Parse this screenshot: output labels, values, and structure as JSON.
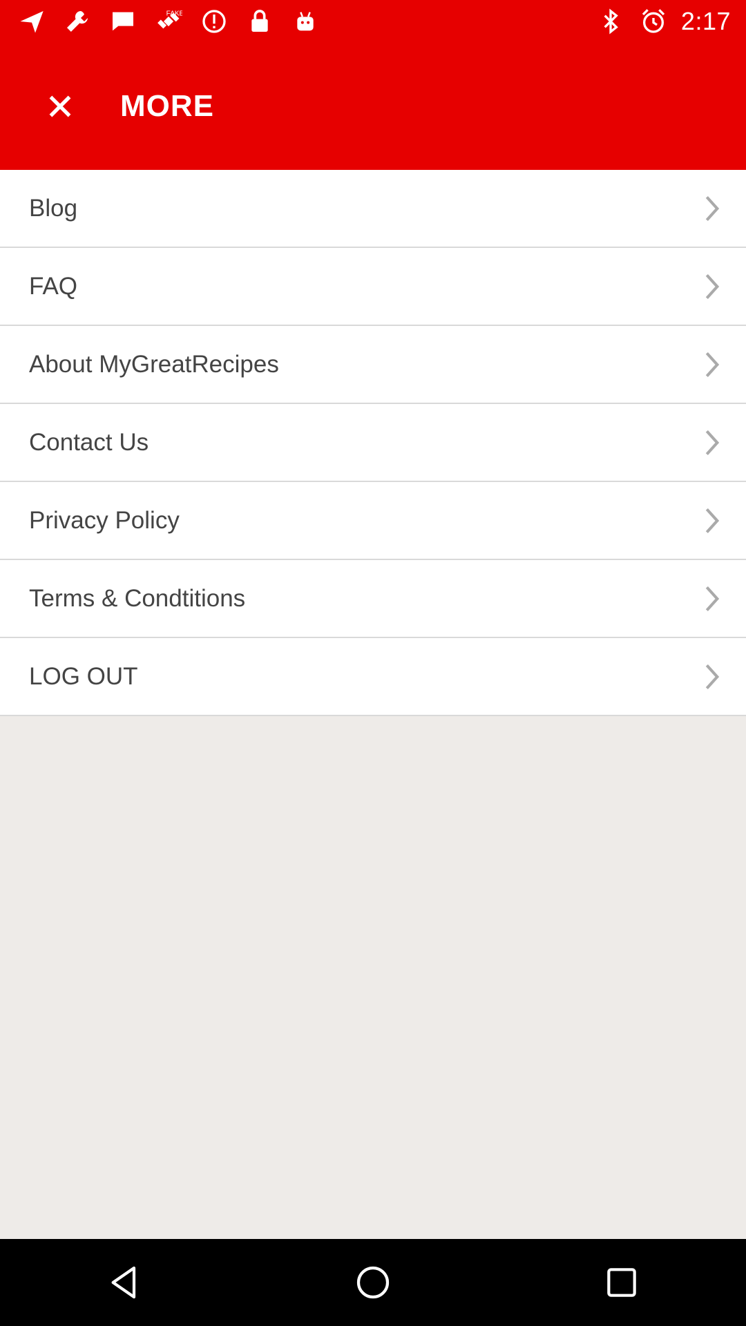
{
  "status_bar": {
    "time": "2:17",
    "icons": [
      "navigation-icon",
      "wrench-icon",
      "message-icon",
      "fake-gps-icon",
      "alert-icon",
      "lock-icon",
      "android-icon",
      "bluetooth-icon",
      "alarm-icon"
    ]
  },
  "header": {
    "title": "MORE",
    "close_icon": "close-icon"
  },
  "menu": {
    "items": [
      {
        "label": "Blog"
      },
      {
        "label": "FAQ"
      },
      {
        "label": "About MyGreatRecipes"
      },
      {
        "label": "Contact Us"
      },
      {
        "label": "Privacy Policy"
      },
      {
        "label": "Terms & Condtitions"
      },
      {
        "label": "LOG OUT"
      }
    ]
  },
  "colors": {
    "brand": "#e60000",
    "background": "#eeebe8",
    "text": "#444444"
  },
  "nav_bar": {
    "icons": [
      "back-icon",
      "home-icon",
      "recents-icon"
    ]
  }
}
